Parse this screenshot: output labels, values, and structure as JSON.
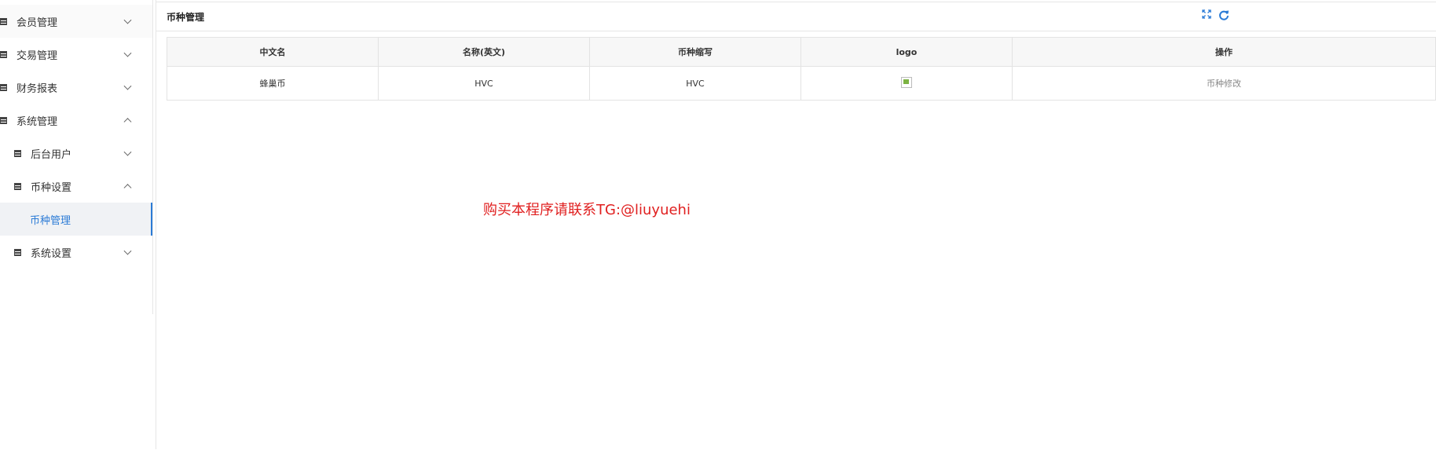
{
  "sidebar": {
    "items": [
      {
        "label": "会员管理"
      },
      {
        "label": "交易管理"
      },
      {
        "label": "财务报表"
      },
      {
        "label": "系统管理"
      },
      {
        "label": "后台用户"
      },
      {
        "label": "币种设置"
      },
      {
        "label": "币种管理"
      },
      {
        "label": "系统设置"
      }
    ]
  },
  "panel": {
    "title": "币种管理",
    "icons": [
      "expand-icon",
      "refresh-icon"
    ]
  },
  "table": {
    "headers": [
      "中文名",
      "名称(英文)",
      "币种缩写",
      "logo",
      "操作"
    ],
    "rows": [
      {
        "cn_name": "蜂巢币",
        "en_name": "HVC",
        "abbr": "HVC",
        "action": "币种修改"
      }
    ]
  },
  "watermark": "购买本程序请联系TG:@liuyuehi",
  "colors": {
    "accent": "#2b7bd6",
    "watermark": "#e02020"
  }
}
